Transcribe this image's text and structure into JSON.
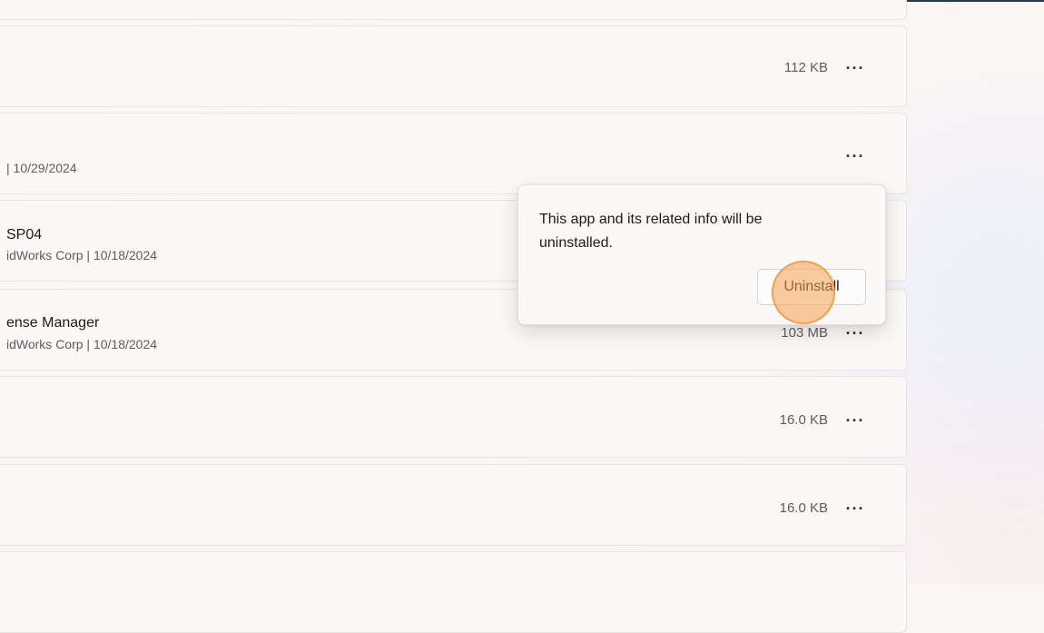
{
  "apps": [
    {
      "name": "",
      "meta": "",
      "size": "112 KB"
    },
    {
      "name": "",
      "meta": "| 10/29/2024",
      "size": ""
    },
    {
      "name": "SP04",
      "meta": "idWorks Corp  |  10/18/2024",
      "size": ""
    },
    {
      "name": "ense Manager",
      "meta": "idWorks Corp  |  10/18/2024",
      "size": "103 MB"
    },
    {
      "name": "",
      "meta": "",
      "size": "16.0 KB"
    },
    {
      "name": "",
      "meta": "",
      "size": "16.0 KB"
    }
  ],
  "more_label": "···",
  "flyout": {
    "message": "This app and its related info will be uninstalled.",
    "button_label": "Uninstall"
  },
  "colors": {
    "accent_marker": "#f5a050",
    "top_strip": "#1f3b57"
  }
}
